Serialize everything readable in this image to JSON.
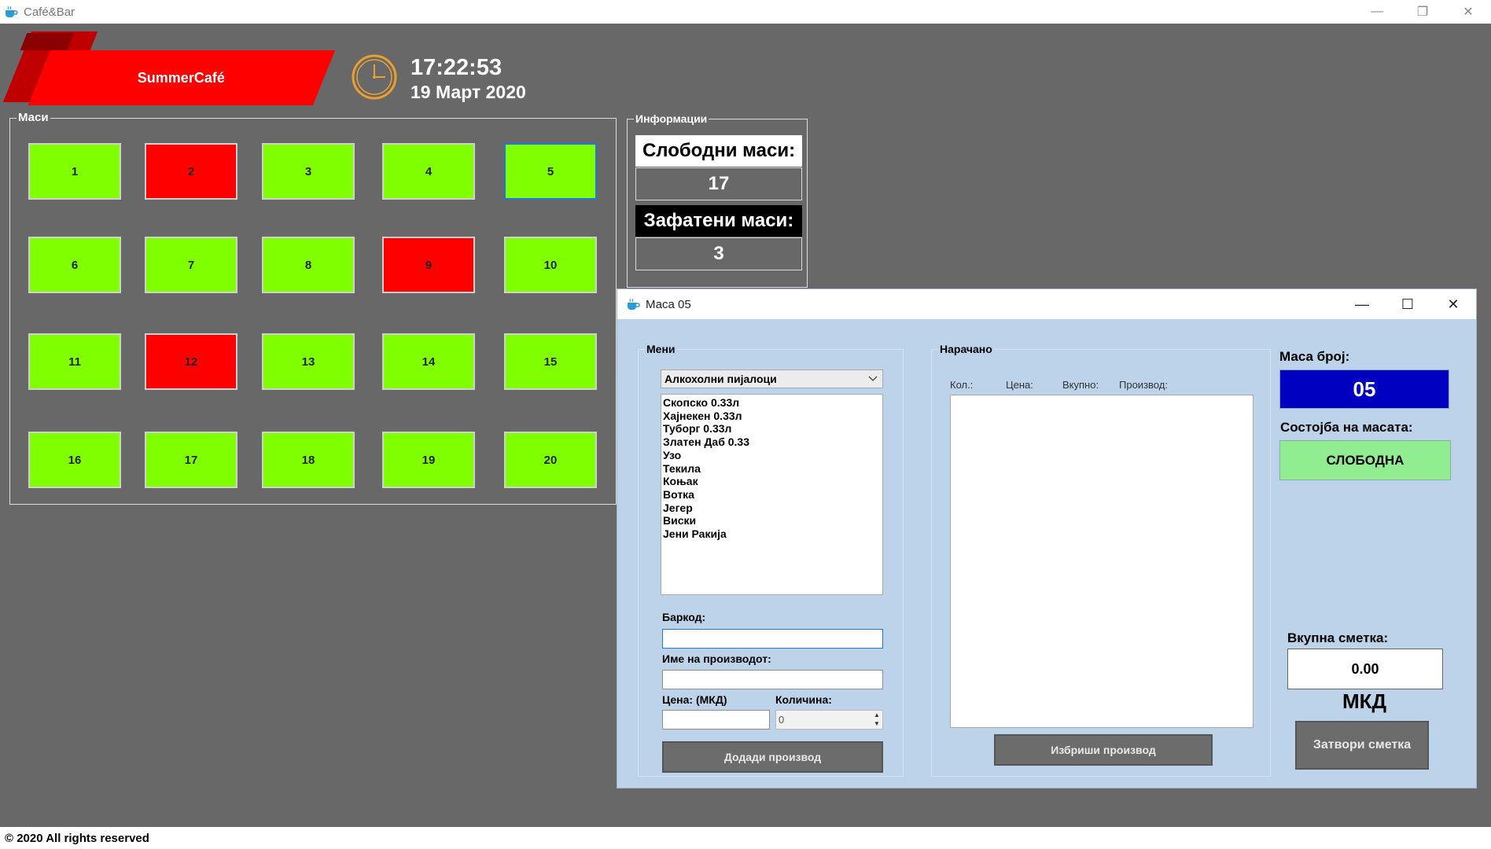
{
  "window": {
    "title": "Café&Bar",
    "icon": "coffee-cup-icon"
  },
  "header": {
    "brand": "SummerCafé",
    "time": "17:22:53",
    "date": "19 Март 2020"
  },
  "tables_panel": {
    "legend": "Маси",
    "tables": [
      {
        "label": "1",
        "status": "free"
      },
      {
        "label": "2",
        "status": "busy"
      },
      {
        "label": "3",
        "status": "free"
      },
      {
        "label": "4",
        "status": "free"
      },
      {
        "label": "5",
        "status": "free"
      },
      {
        "label": "6",
        "status": "free"
      },
      {
        "label": "7",
        "status": "free"
      },
      {
        "label": "8",
        "status": "free"
      },
      {
        "label": "9",
        "status": "busy"
      },
      {
        "label": "10",
        "status": "free"
      },
      {
        "label": "11",
        "status": "free"
      },
      {
        "label": "12",
        "status": "busy"
      },
      {
        "label": "13",
        "status": "free"
      },
      {
        "label": "14",
        "status": "free"
      },
      {
        "label": "15",
        "status": "free"
      },
      {
        "label": "16",
        "status": "free"
      },
      {
        "label": "17",
        "status": "free"
      },
      {
        "label": "18",
        "status": "free"
      },
      {
        "label": "19",
        "status": "free"
      },
      {
        "label": "20",
        "status": "free"
      }
    ]
  },
  "info_panel": {
    "legend": "Информации",
    "free_label": "Слободни маси:",
    "free_count": "17",
    "busy_label": "Зафатени маси:",
    "busy_count": "3"
  },
  "dialog": {
    "title": "Маса 05",
    "menu": {
      "legend": "Мени",
      "category": "Алкохолни пијалоци",
      "items": [
        "Скопско 0.33л",
        "Хајнекен 0.33л",
        "Туборг 0.33л",
        "Златен Даб 0.33",
        "Узо",
        "Текила",
        "Коњак",
        "Вотка",
        "Јегер",
        "Виски",
        "Јени Ракија"
      ],
      "barcode_label": "Баркод:",
      "barcode_value": "",
      "product_name_label": "Име на производот:",
      "product_name_value": "",
      "price_label": "Цена: (МКД)",
      "price_value": "",
      "quantity_label": "Количина:",
      "quantity_value": "0",
      "add_button": "Додади производ"
    },
    "ordered": {
      "legend": "Нарачано",
      "columns": [
        "Кол.:",
        "Цена:",
        "Вкупно:",
        "Производ:"
      ],
      "delete_button": "Избриши производ"
    },
    "right": {
      "table_no_label": "Маса број:",
      "table_no": "05",
      "state_label": "Состојба на масата:",
      "state": "СЛОБОДНА",
      "total_label": "Вкупна сметка:",
      "total": "0.00",
      "currency": "МКД",
      "close_button": "Затвори сметка"
    }
  },
  "footer": "© 2020 All rights reserved",
  "colors": {
    "free": "#80ff00",
    "busy": "#ff0000",
    "background": "#686868",
    "dialog_bg": "#bdd3ea",
    "table_no_bg": "#0000c0",
    "state_bg": "#90ee90"
  }
}
